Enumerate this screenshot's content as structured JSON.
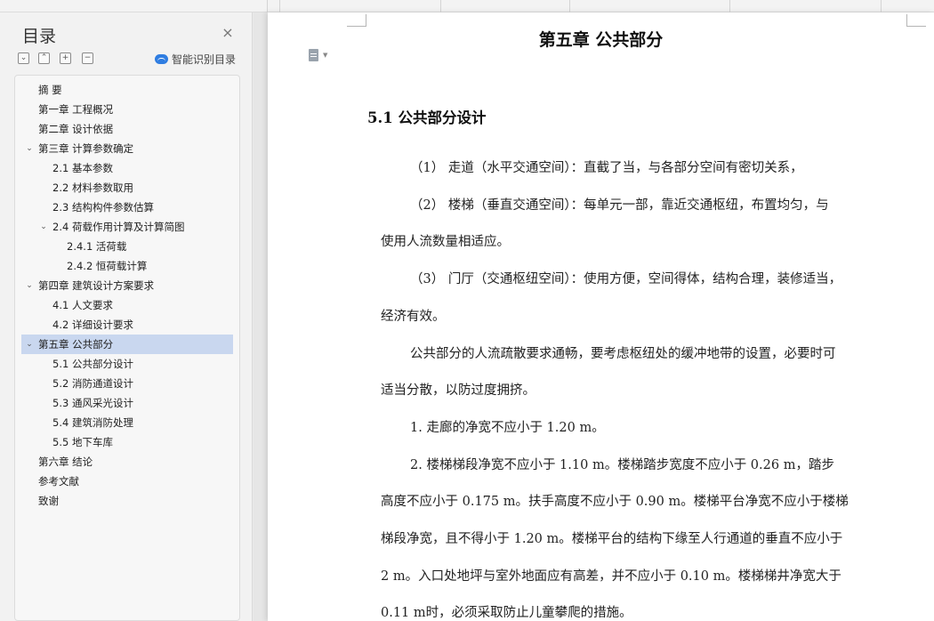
{
  "nav": {
    "title": "目录",
    "close_icon": "×",
    "tools": [
      "⌄",
      "⌃",
      "+",
      "−"
    ],
    "smart_label": "智能识别目录",
    "items": [
      {
        "label": "摘  要",
        "level": 1,
        "expand": ""
      },
      {
        "label": "第一章  工程概况",
        "level": 1,
        "expand": ""
      },
      {
        "label": "第二章  设计依据",
        "level": 1,
        "expand": ""
      },
      {
        "label": "第三章  计算参数确定",
        "level": 1,
        "expand": "⌄"
      },
      {
        "label": "2.1  基本参数",
        "level": 2,
        "expand": ""
      },
      {
        "label": "2.2  材料参数取用",
        "level": 2,
        "expand": ""
      },
      {
        "label": "2.3  结构构件参数估算",
        "level": 2,
        "expand": ""
      },
      {
        "label": "2.4  荷载作用计算及计算简图",
        "level": 2,
        "expand": "⌄"
      },
      {
        "label": "2.4.1  活荷载",
        "level": 3,
        "expand": ""
      },
      {
        "label": "2.4.2  恒荷载计算",
        "level": 3,
        "expand": ""
      },
      {
        "label": "第四章  建筑设计方案要求",
        "level": 1,
        "expand": "⌄"
      },
      {
        "label": "4.1 人文要求",
        "level": 2,
        "expand": ""
      },
      {
        "label": "4.2 详细设计要求",
        "level": 2,
        "expand": ""
      },
      {
        "label": "第五章  公共部分",
        "level": 1,
        "expand": "⌄"
      },
      {
        "label": "5.1 公共部分设计",
        "level": 2,
        "expand": ""
      },
      {
        "label": "5.2 消防通道设计",
        "level": 2,
        "expand": ""
      },
      {
        "label": "5.3 通风采光设计",
        "level": 2,
        "expand": ""
      },
      {
        "label": "5.4 建筑消防处理",
        "level": 2,
        "expand": ""
      },
      {
        "label": "5.5 地下车库",
        "level": 2,
        "expand": ""
      },
      {
        "label": "第六章  结论",
        "level": 1,
        "expand": ""
      },
      {
        "label": "参考文献",
        "level": 1,
        "expand": ""
      },
      {
        "label": "致谢",
        "level": 1,
        "expand": ""
      }
    ],
    "active_index": 13
  },
  "doc": {
    "chapter_title": "第五章  公共部分",
    "section_title": "5.1 公共部分设计",
    "lines": [
      {
        "text": "（1）  走道（水平交通空间）：直截了当，与各部分空间有密切关系，",
        "indent": true
      },
      {
        "text": "（2）  楼梯（垂直交通空间）：每单元一部，靠近交通枢纽，布置均匀，与",
        "indent": true
      },
      {
        "text": "使用人流数量相适应。",
        "indent": false
      },
      {
        "text": "（3）  门厅（交通枢纽空间）：使用方便，空间得体，结构合理，装修适当，",
        "indent": true
      },
      {
        "text": "经济有效。",
        "indent": false
      },
      {
        "text": "公共部分的人流疏散要求通畅，要考虑枢纽处的缓冲地带的设置，必要时可",
        "indent": true
      },
      {
        "text": "适当分散，以防过度拥挤。",
        "indent": false
      },
      {
        "text": "1.    走廊的净宽不应小于 1.20 m。",
        "indent": true
      },
      {
        "text": "2.    楼梯梯段净宽不应小于 1.10 m。楼梯踏步宽度不应小于 0.26 m，踏步",
        "indent": true
      },
      {
        "text": "高度不应小于 0.175 m。扶手高度不应小于 0.90 m。楼梯平台净宽不应小于楼梯",
        "indent": false
      },
      {
        "text": "梯段净宽，且不得小于 1.20 m。楼梯平台的结构下缘至人行通道的垂直不应小于",
        "indent": false
      },
      {
        "text": "2 m。入口处地坪与室外地面应有高差，并不应小于 0.10 m。楼梯梯井净宽大于",
        "indent": false
      },
      {
        "text": "0.11 m时，必须采取防止儿童攀爬的措施。",
        "indent": false
      }
    ]
  },
  "colors": {
    "active_bg": "#c9d7ef",
    "smart_icon": "#2f7de1"
  }
}
